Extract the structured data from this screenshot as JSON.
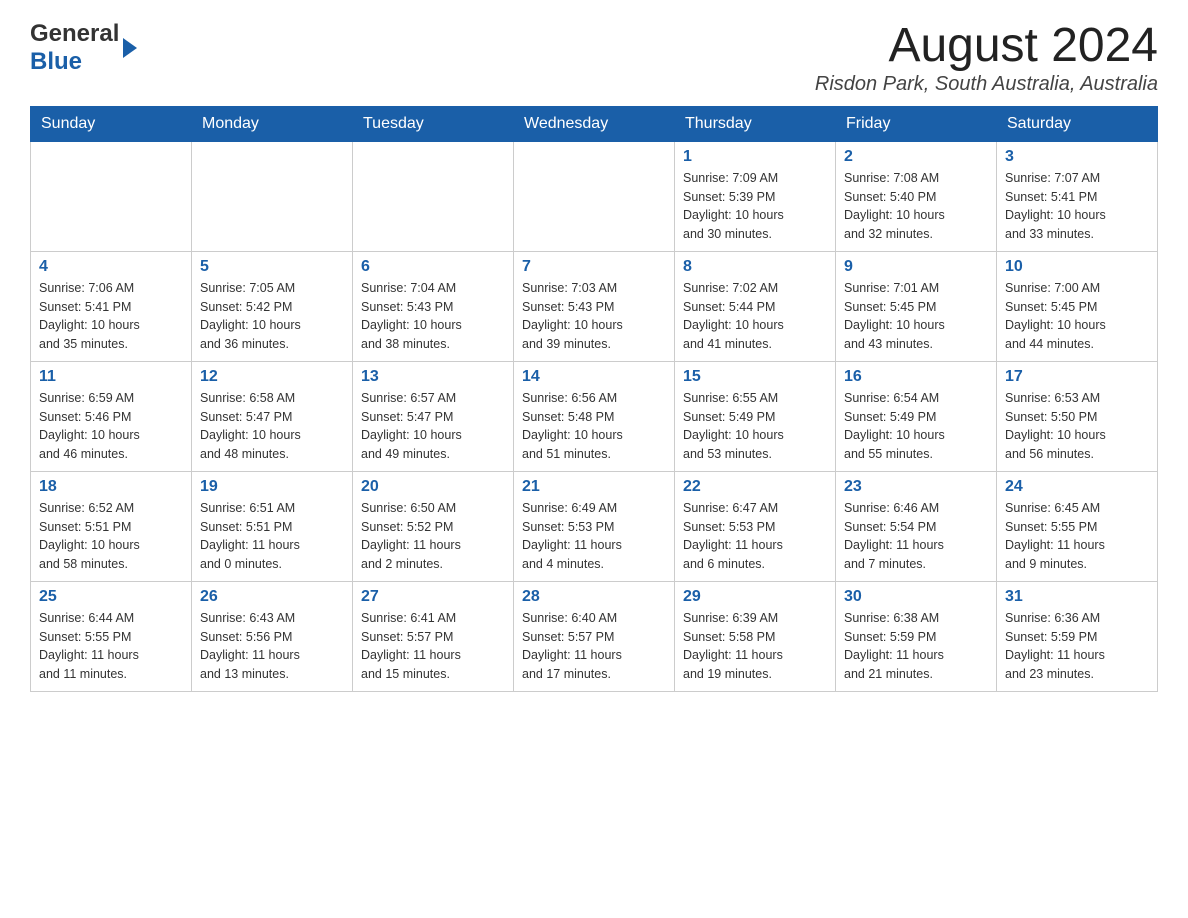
{
  "logo": {
    "general": "General",
    "blue": "Blue"
  },
  "title": {
    "month_year": "August 2024",
    "location": "Risdon Park, South Australia, Australia"
  },
  "weekdays": [
    "Sunday",
    "Monday",
    "Tuesday",
    "Wednesday",
    "Thursday",
    "Friday",
    "Saturday"
  ],
  "weeks": [
    [
      {
        "day": "",
        "info": ""
      },
      {
        "day": "",
        "info": ""
      },
      {
        "day": "",
        "info": ""
      },
      {
        "day": "",
        "info": ""
      },
      {
        "day": "1",
        "info": "Sunrise: 7:09 AM\nSunset: 5:39 PM\nDaylight: 10 hours\nand 30 minutes."
      },
      {
        "day": "2",
        "info": "Sunrise: 7:08 AM\nSunset: 5:40 PM\nDaylight: 10 hours\nand 32 minutes."
      },
      {
        "day": "3",
        "info": "Sunrise: 7:07 AM\nSunset: 5:41 PM\nDaylight: 10 hours\nand 33 minutes."
      }
    ],
    [
      {
        "day": "4",
        "info": "Sunrise: 7:06 AM\nSunset: 5:41 PM\nDaylight: 10 hours\nand 35 minutes."
      },
      {
        "day": "5",
        "info": "Sunrise: 7:05 AM\nSunset: 5:42 PM\nDaylight: 10 hours\nand 36 minutes."
      },
      {
        "day": "6",
        "info": "Sunrise: 7:04 AM\nSunset: 5:43 PM\nDaylight: 10 hours\nand 38 minutes."
      },
      {
        "day": "7",
        "info": "Sunrise: 7:03 AM\nSunset: 5:43 PM\nDaylight: 10 hours\nand 39 minutes."
      },
      {
        "day": "8",
        "info": "Sunrise: 7:02 AM\nSunset: 5:44 PM\nDaylight: 10 hours\nand 41 minutes."
      },
      {
        "day": "9",
        "info": "Sunrise: 7:01 AM\nSunset: 5:45 PM\nDaylight: 10 hours\nand 43 minutes."
      },
      {
        "day": "10",
        "info": "Sunrise: 7:00 AM\nSunset: 5:45 PM\nDaylight: 10 hours\nand 44 minutes."
      }
    ],
    [
      {
        "day": "11",
        "info": "Sunrise: 6:59 AM\nSunset: 5:46 PM\nDaylight: 10 hours\nand 46 minutes."
      },
      {
        "day": "12",
        "info": "Sunrise: 6:58 AM\nSunset: 5:47 PM\nDaylight: 10 hours\nand 48 minutes."
      },
      {
        "day": "13",
        "info": "Sunrise: 6:57 AM\nSunset: 5:47 PM\nDaylight: 10 hours\nand 49 minutes."
      },
      {
        "day": "14",
        "info": "Sunrise: 6:56 AM\nSunset: 5:48 PM\nDaylight: 10 hours\nand 51 minutes."
      },
      {
        "day": "15",
        "info": "Sunrise: 6:55 AM\nSunset: 5:49 PM\nDaylight: 10 hours\nand 53 minutes."
      },
      {
        "day": "16",
        "info": "Sunrise: 6:54 AM\nSunset: 5:49 PM\nDaylight: 10 hours\nand 55 minutes."
      },
      {
        "day": "17",
        "info": "Sunrise: 6:53 AM\nSunset: 5:50 PM\nDaylight: 10 hours\nand 56 minutes."
      }
    ],
    [
      {
        "day": "18",
        "info": "Sunrise: 6:52 AM\nSunset: 5:51 PM\nDaylight: 10 hours\nand 58 minutes."
      },
      {
        "day": "19",
        "info": "Sunrise: 6:51 AM\nSunset: 5:51 PM\nDaylight: 11 hours\nand 0 minutes."
      },
      {
        "day": "20",
        "info": "Sunrise: 6:50 AM\nSunset: 5:52 PM\nDaylight: 11 hours\nand 2 minutes."
      },
      {
        "day": "21",
        "info": "Sunrise: 6:49 AM\nSunset: 5:53 PM\nDaylight: 11 hours\nand 4 minutes."
      },
      {
        "day": "22",
        "info": "Sunrise: 6:47 AM\nSunset: 5:53 PM\nDaylight: 11 hours\nand 6 minutes."
      },
      {
        "day": "23",
        "info": "Sunrise: 6:46 AM\nSunset: 5:54 PM\nDaylight: 11 hours\nand 7 minutes."
      },
      {
        "day": "24",
        "info": "Sunrise: 6:45 AM\nSunset: 5:55 PM\nDaylight: 11 hours\nand 9 minutes."
      }
    ],
    [
      {
        "day": "25",
        "info": "Sunrise: 6:44 AM\nSunset: 5:55 PM\nDaylight: 11 hours\nand 11 minutes."
      },
      {
        "day": "26",
        "info": "Sunrise: 6:43 AM\nSunset: 5:56 PM\nDaylight: 11 hours\nand 13 minutes."
      },
      {
        "day": "27",
        "info": "Sunrise: 6:41 AM\nSunset: 5:57 PM\nDaylight: 11 hours\nand 15 minutes."
      },
      {
        "day": "28",
        "info": "Sunrise: 6:40 AM\nSunset: 5:57 PM\nDaylight: 11 hours\nand 17 minutes."
      },
      {
        "day": "29",
        "info": "Sunrise: 6:39 AM\nSunset: 5:58 PM\nDaylight: 11 hours\nand 19 minutes."
      },
      {
        "day": "30",
        "info": "Sunrise: 6:38 AM\nSunset: 5:59 PM\nDaylight: 11 hours\nand 21 minutes."
      },
      {
        "day": "31",
        "info": "Sunrise: 6:36 AM\nSunset: 5:59 PM\nDaylight: 11 hours\nand 23 minutes."
      }
    ]
  ]
}
